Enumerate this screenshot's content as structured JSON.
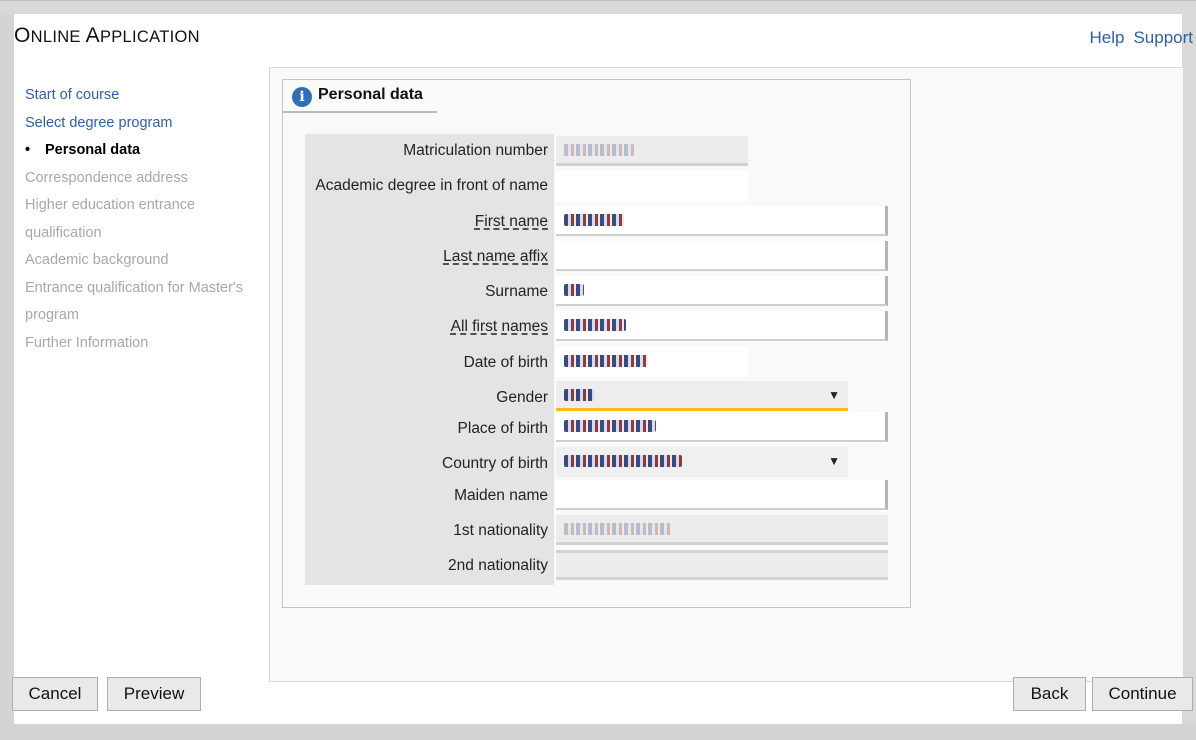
{
  "header": {
    "title_first_letter": "O",
    "title_rest_1": "NLINE ",
    "title_second_letter": "A",
    "title_rest_2": "PPLICATION",
    "links": [
      "Help",
      "Support"
    ]
  },
  "nav": {
    "items": [
      {
        "label": "Start of course",
        "state": "link"
      },
      {
        "label": "Select degree program",
        "state": "link"
      },
      {
        "label": "Personal data",
        "state": "current"
      },
      {
        "label": "Correspondence address",
        "state": "disabled"
      },
      {
        "label": "Higher education entrance qualification",
        "state": "disabled"
      },
      {
        "label": "Academic background",
        "state": "disabled"
      },
      {
        "label": "Entrance qualification for Master's program",
        "state": "disabled"
      },
      {
        "label": "Further Information",
        "state": "disabled"
      }
    ]
  },
  "section": {
    "tab_label": "Personal data",
    "info_icon": "info-icon"
  },
  "form": {
    "labels": {
      "matriculation_number": "Matriculation number",
      "academic_degree": "Academic degree in front of name",
      "first_name": "First name",
      "last_name_affix": "Last name affix",
      "surname": "Surname",
      "all_first_names": "All first names",
      "date_of_birth": "Date of birth",
      "gender": "Gender",
      "place_of_birth": "Place of birth",
      "country_of_birth": "Country of birth",
      "maiden_name": "Maiden name",
      "nationality_1": "1st nationality",
      "nationality_2": "2nd nationality"
    }
  },
  "buttons": {
    "cancel": "Cancel",
    "preview": "Preview",
    "back": "Back",
    "continue": "Continue"
  },
  "colors": {
    "link": "#2f5fa6",
    "disabled": "#a8a8a8",
    "gender_focus": "#f4bd1a",
    "info_icon": "#2e6fb6"
  }
}
